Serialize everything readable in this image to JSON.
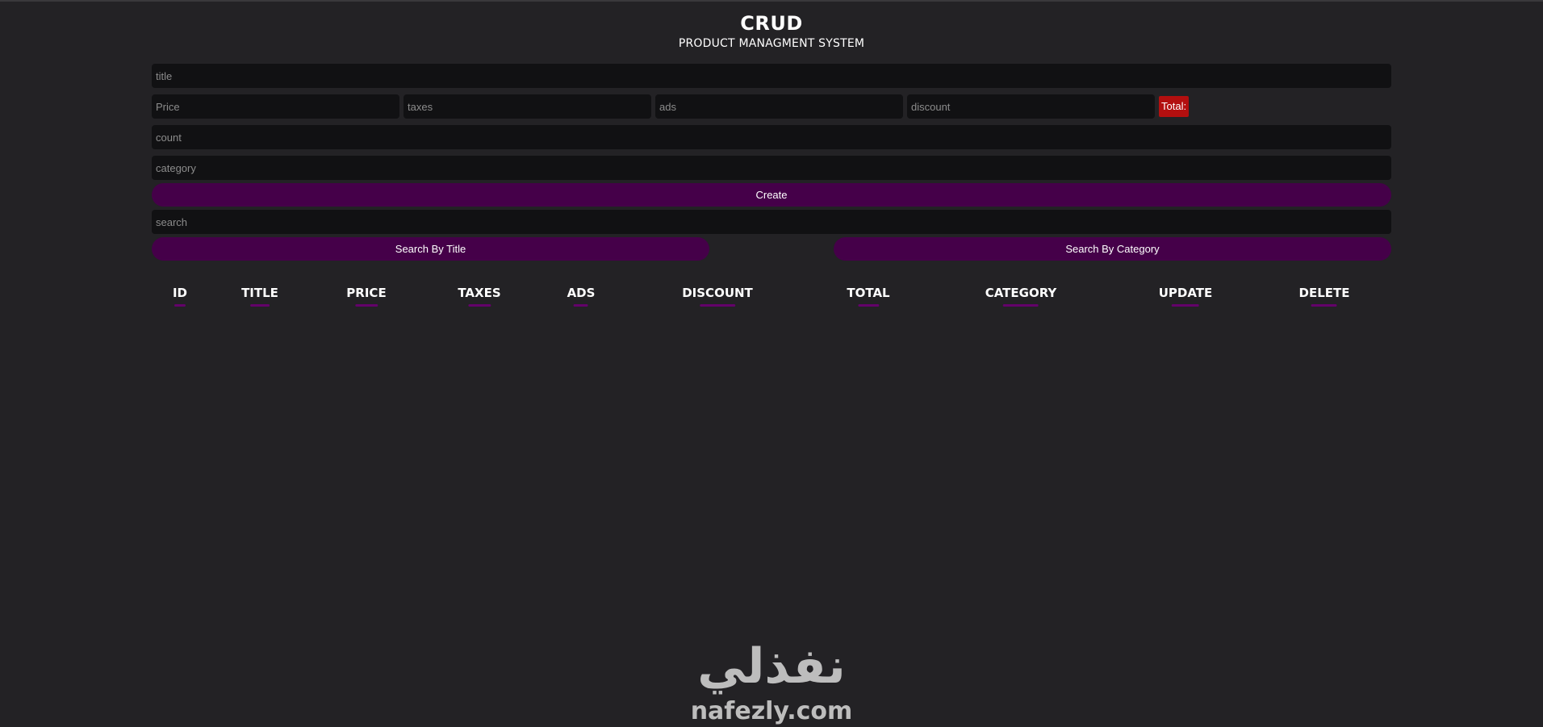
{
  "header": {
    "title": "CRUD",
    "subtitle": "PRODUCT MANAGMENT SYSTEM"
  },
  "form": {
    "title_placeholder": "title",
    "price_placeholder": "Price",
    "taxes_placeholder": "taxes",
    "ads_placeholder": "ads",
    "discount_placeholder": "discount",
    "total_label": "Total:",
    "count_placeholder": "count",
    "category_placeholder": "category",
    "create_label": "Create"
  },
  "search": {
    "placeholder": "search",
    "by_title_label": "Search By Title",
    "by_category_label": "Search By Category"
  },
  "table": {
    "columns": [
      "ID",
      "TITLE",
      "PRICE",
      "TAXES",
      "ADS",
      "DISCOUNT",
      "TOTAL",
      "CATEGORY",
      "UPDATE",
      "DELETE"
    ]
  },
  "watermark": {
    "arabic": "نفذلي",
    "latin": "nafezly.com"
  },
  "colors": {
    "background": "#232225",
    "input": "#111113",
    "accent_purple": "#450049",
    "underline_purple": "#63016a",
    "total_red": "#b30f0f"
  }
}
